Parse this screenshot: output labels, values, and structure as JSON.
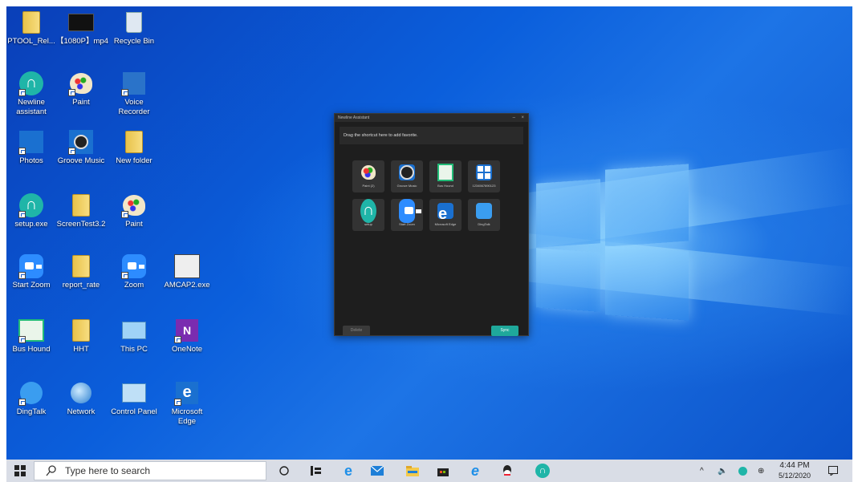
{
  "desktop": {
    "icons": [
      {
        "label": "PTOOL_Rel...",
        "icon": "folder-icon"
      },
      {
        "label": "【1080P】mp4",
        "icon": "video-file-icon"
      },
      {
        "label": "Recycle Bin",
        "icon": "recycle-bin-icon"
      },
      {
        "label": "Newline assistant",
        "icon": "newline-icon"
      },
      {
        "label": "Paint",
        "icon": "paint-icon"
      },
      {
        "label": "Voice Recorder",
        "icon": "voice-recorder-icon"
      },
      {
        "label": "Photos",
        "icon": "photos-icon"
      },
      {
        "label": "Groove Music",
        "icon": "groove-music-icon"
      },
      {
        "label": "New folder",
        "icon": "folder-icon"
      },
      {
        "label": "setup.exe",
        "icon": "newline-icon"
      },
      {
        "label": "ScreenTest3.2",
        "icon": "folder-icon"
      },
      {
        "label": "Paint",
        "icon": "paint-icon"
      },
      {
        "label": "Start Zoom",
        "icon": "zoom-icon"
      },
      {
        "label": "report_rate",
        "icon": "folder-icon"
      },
      {
        "label": "Zoom",
        "icon": "zoom-icon"
      },
      {
        "label": "AMCAP2.exe",
        "icon": "amcap-icon"
      },
      {
        "label": "Bus Hound",
        "icon": "bus-hound-icon"
      },
      {
        "label": "HHT",
        "icon": "folder-icon"
      },
      {
        "label": "This PC",
        "icon": "this-pc-icon"
      },
      {
        "label": "OneNote",
        "icon": "onenote-icon"
      },
      {
        "label": "DingTalk",
        "icon": "dingtalk-icon"
      },
      {
        "label": "Network",
        "icon": "network-icon"
      },
      {
        "label": "Control Panel",
        "icon": "control-panel-icon"
      },
      {
        "label": "Microsoft Edge",
        "icon": "edge-icon"
      }
    ]
  },
  "window": {
    "title": "Newline Assistant",
    "hint": "Drag the shortcut here to add favorite.",
    "tiles": [
      {
        "label": "Paint (2)",
        "icon": "paint-icon"
      },
      {
        "label": "Groove Music",
        "icon": "groove-music-icon"
      },
      {
        "label": "Bus Hound",
        "icon": "bus-hound-icon"
      },
      {
        "label": "1234567890123",
        "icon": "windows-icon"
      },
      {
        "label": "setup",
        "icon": "newline-icon"
      },
      {
        "label": "Start Zoom",
        "icon": "zoom-icon"
      },
      {
        "label": "Microsoft Edge",
        "icon": "edge-icon"
      },
      {
        "label": "DingTalk",
        "icon": "dingtalk-icon"
      }
    ],
    "delete_label": "Delete",
    "sync_label": "Sync"
  },
  "taskbar": {
    "search_placeholder": "Type here to search",
    "time": "4:44 PM",
    "date": "5/12/2020"
  }
}
